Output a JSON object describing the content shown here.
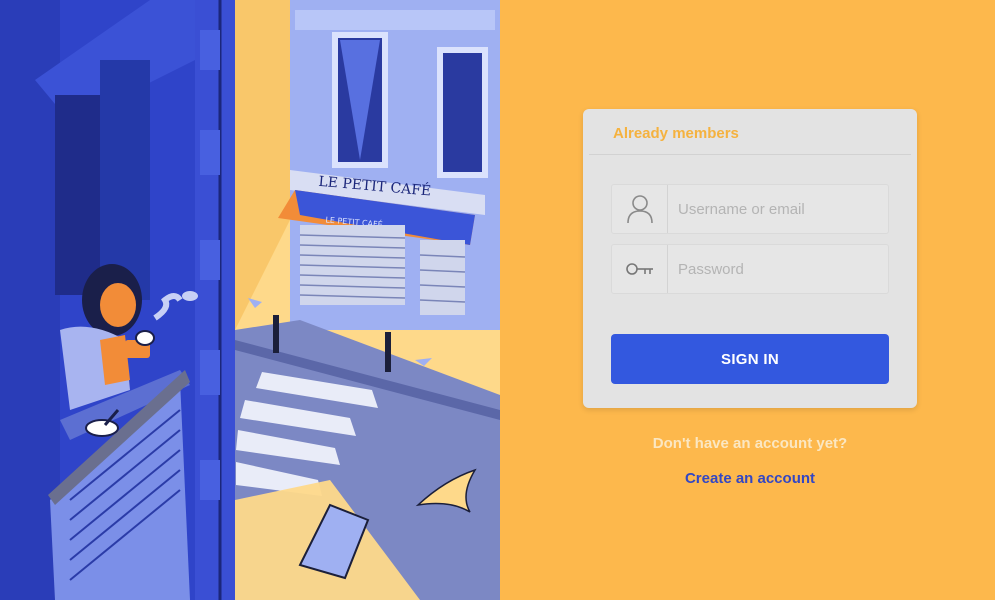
{
  "card": {
    "header": "Already members"
  },
  "form": {
    "username_placeholder": "Username or email",
    "password_placeholder": "Password",
    "submit_label": "SIGN IN"
  },
  "footer": {
    "prompt": "Don't have an account yet?",
    "create_link": "Create an account"
  },
  "illustration": {
    "cafe_sign": "LE PETIT CAFÉ",
    "awning_text": "LE PETIT CAFÉ"
  },
  "icons": {
    "username": "user-icon",
    "password": "key-icon"
  },
  "colors": {
    "background": "#fdb84c",
    "card": "#e3e3e3",
    "header_text": "#f5b23f",
    "button": "#3358df",
    "link": "#3347c4",
    "prompt_text": "#fbe7c2",
    "illustration_blue": "#2f44c9"
  }
}
